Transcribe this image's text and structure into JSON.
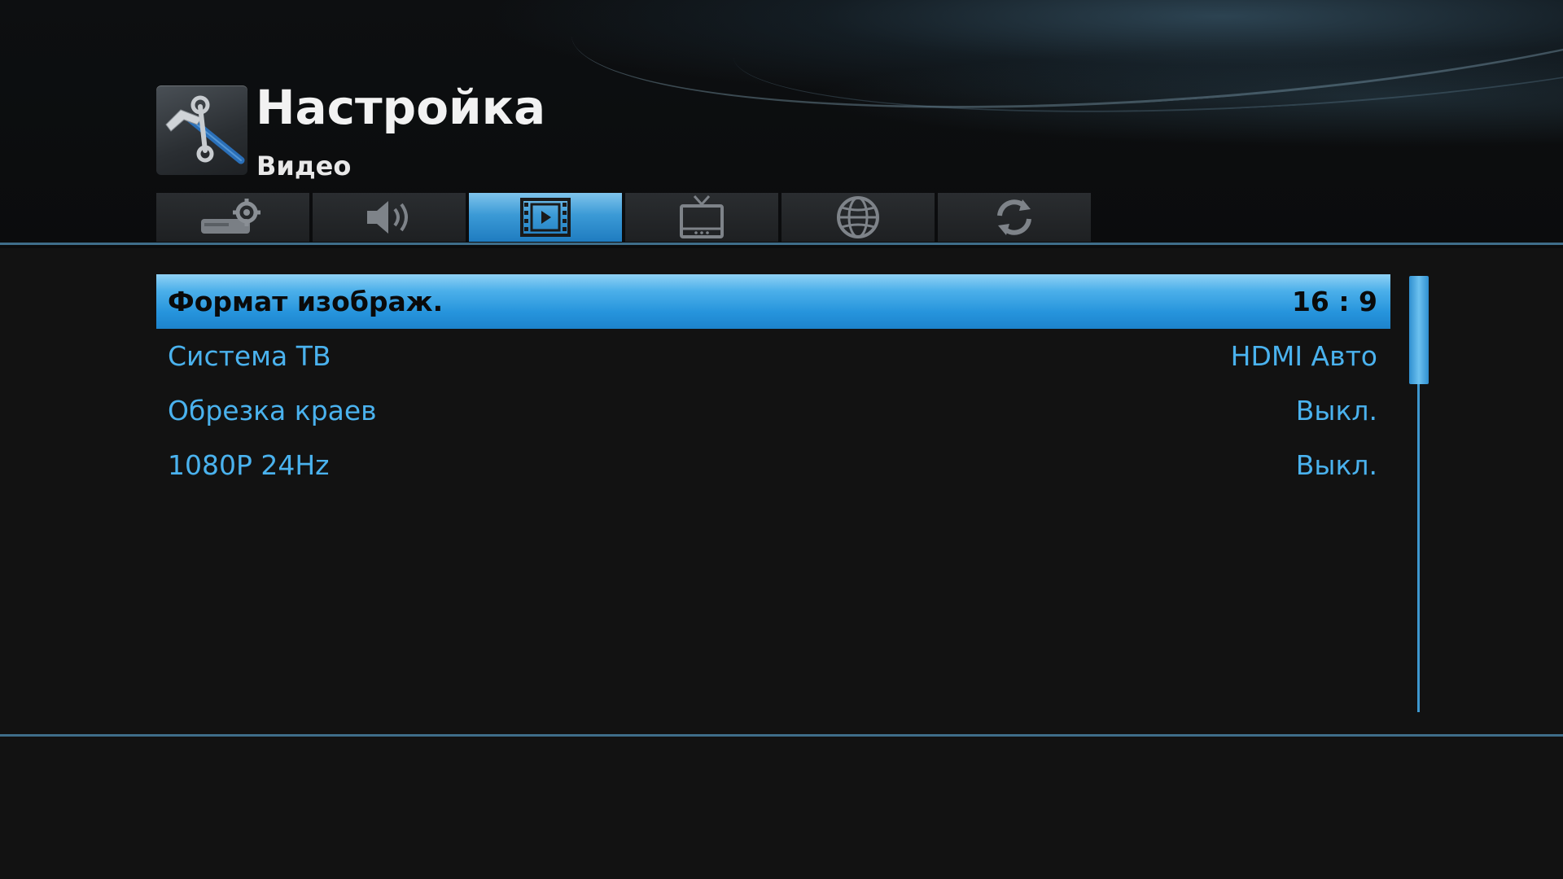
{
  "header": {
    "title": "Настройка",
    "subtitle": "Видео",
    "icon": "wrench-hammer-icon"
  },
  "tabs": [
    {
      "icon": "system-settings-icon",
      "active": false
    },
    {
      "icon": "speaker-audio-icon",
      "active": false
    },
    {
      "icon": "film-video-icon",
      "active": true
    },
    {
      "icon": "tv-icon",
      "active": false
    },
    {
      "icon": "globe-network-icon",
      "active": false
    },
    {
      "icon": "refresh-update-icon",
      "active": false
    }
  ],
  "menu": {
    "items": [
      {
        "label": "Формат изображ.",
        "value": "16 : 9",
        "selected": true
      },
      {
        "label": "Система ТВ",
        "value": "HDMI Авто",
        "selected": false
      },
      {
        "label": "Обрезка краев",
        "value": "Выкл.",
        "selected": false
      },
      {
        "label": "1080P 24Hz",
        "value": "Выкл.",
        "selected": false
      }
    ]
  },
  "colors": {
    "accent": "#2a9ae0",
    "text_blue": "#4ab2ee",
    "background": "#121212",
    "rule": "#3f6e8a"
  }
}
